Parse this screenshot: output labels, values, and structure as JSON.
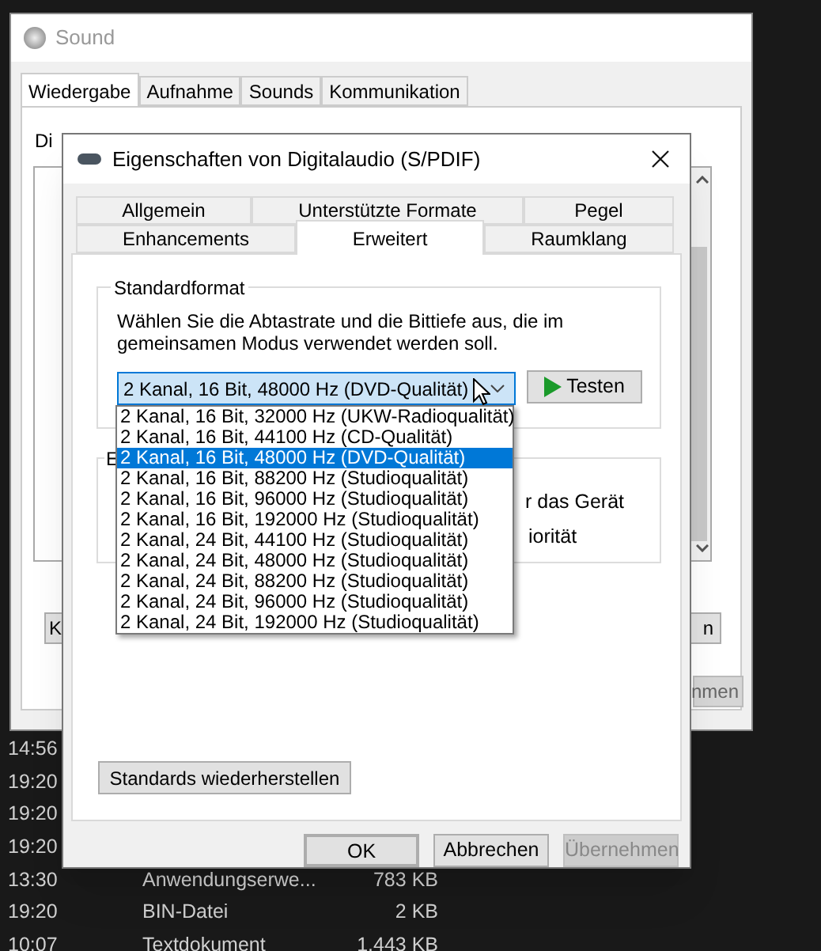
{
  "background_list": {
    "rows": [
      {
        "time": "14:56"
      },
      {
        "time": "19:20"
      },
      {
        "time": "19:20"
      },
      {
        "time": "19:20"
      },
      {
        "time": "13:30",
        "type": "Anwendungserwe...",
        "size": "783 KB"
      },
      {
        "time": "19:20",
        "type": "BIN-Datei",
        "size": "2 KB"
      },
      {
        "time": "10:07",
        "type": "Textdokument",
        "size": "1.443 KB"
      }
    ]
  },
  "sound_window": {
    "title": "Sound",
    "tabs": [
      {
        "label": "Wiedergabe",
        "selected": true
      },
      {
        "label": "Aufnahme",
        "selected": false
      },
      {
        "label": "Sounds",
        "selected": false
      },
      {
        "label": "Kommunikation",
        "selected": false
      }
    ],
    "intro": "Di",
    "buttons": [
      {
        "label": "K",
        "disabled": false
      },
      {
        "label": "n",
        "disabled": false
      },
      {
        "label": "nmen",
        "disabled": true
      }
    ]
  },
  "dialog": {
    "title": "Eigenschaften von Digitalaudio (S/PDIF)",
    "tab_rows": [
      [
        {
          "label": "Allgemein",
          "selected": false
        },
        {
          "label": "Unterstützte Formate",
          "selected": false
        },
        {
          "label": "Pegel",
          "selected": false
        }
      ],
      [
        {
          "label": "Enhancements",
          "selected": false
        },
        {
          "label": "Erweitert",
          "selected": true
        },
        {
          "label": "Raumklang",
          "selected": false
        }
      ]
    ],
    "default_format": {
      "title": "Standardformat",
      "description": "Wählen Sie die Abtastrate und die Bittiefe aus, die im gemeinsamen Modus verwendet werden soll.",
      "select": {
        "value": "2 Kanal, 16 Bit, 48000 Hz (DVD-Qualität)",
        "expanded": true,
        "options": [
          {
            "label": "2 Kanal, 16 Bit, 32000 Hz (UKW-Radioqualität)",
            "selected": false
          },
          {
            "label": "2 Kanal, 16 Bit, 44100 Hz (CD-Qualität)",
            "selected": false
          },
          {
            "label": "2 Kanal, 16 Bit, 48000 Hz (DVD-Qualität)",
            "selected": true
          },
          {
            "label": "2 Kanal, 16 Bit, 88200 Hz (Studioqualität)",
            "selected": false
          },
          {
            "label": "2 Kanal, 16 Bit, 96000 Hz (Studioqualität)",
            "selected": false
          },
          {
            "label": "2 Kanal, 16 Bit, 192000 Hz (Studioqualität)",
            "selected": false
          },
          {
            "label": "2 Kanal, 24 Bit, 44100 Hz (Studioqualität)",
            "selected": false
          },
          {
            "label": "2 Kanal, 24 Bit, 48000 Hz (Studioqualität)",
            "selected": false
          },
          {
            "label": "2 Kanal, 24 Bit, 88200 Hz (Studioqualität)",
            "selected": false
          },
          {
            "label": "2 Kanal, 24 Bit, 96000 Hz (Studioqualität)",
            "selected": false
          },
          {
            "label": "2 Kanal, 24 Bit, 192000 Hz (Studioqualität)",
            "selected": false
          }
        ]
      },
      "test_button": "Testen"
    },
    "exclusive_group": {
      "title": "E",
      "lines": [
        "r das Gerät",
        "iorität"
      ]
    },
    "restore_button": "Standards wiederherstellen",
    "buttons": [
      {
        "label": "OK",
        "default": true,
        "disabled": false
      },
      {
        "label": "Abbrechen",
        "default": false,
        "disabled": false
      },
      {
        "label": "Übernehmen",
        "default": false,
        "disabled": true
      }
    ]
  }
}
